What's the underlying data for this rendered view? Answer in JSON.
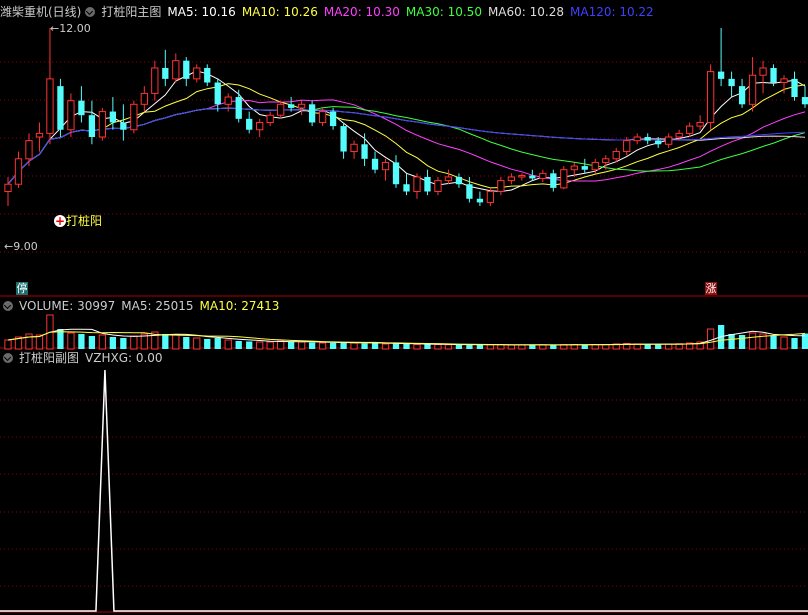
{
  "main_panel": {
    "stock_name": "潍柴重机(日线)",
    "indicator_name": "打桩阳主图",
    "ma": [
      {
        "label": "MA5: 10.16",
        "color": "#ffffff"
      },
      {
        "label": "MA10: 10.26",
        "color": "#ffff40"
      },
      {
        "label": "MA20: 10.30",
        "color": "#ff40ff"
      },
      {
        "label": "MA30: 10.50",
        "color": "#40ff40"
      },
      {
        "label": "MA60: 10.28",
        "color": "#dddddd"
      },
      {
        "label": "MA120: 10.22",
        "color": "#4040ff"
      }
    ],
    "high_label": "12.00",
    "low_label": "9.00",
    "signal_label": "打桩阳",
    "badge_left": "停",
    "badge_right": "涨"
  },
  "volume_panel": {
    "title": "VOLUME: 30997",
    "ma5": "MA5: 25015",
    "ma10": "MA10: 27413"
  },
  "sub_panel": {
    "title": "打桩阳副图",
    "value": "VZHXG: 0.00"
  },
  "colors": {
    "up": "#ff3232",
    "down": "#54fcfc",
    "grid": "#8b0000",
    "ma5": "#ffffff",
    "ma10": "#ffff40",
    "ma20": "#ff40ff",
    "ma30": "#40ff40",
    "ma60": "#dddddd",
    "ma120": "#4040ff"
  },
  "chart_data": {
    "type": "candlestick",
    "price_range": [
      9.0,
      12.0
    ],
    "candles": [
      [
        9.75,
        9.95,
        9.55,
        9.85
      ],
      [
        9.85,
        10.3,
        9.8,
        10.2
      ],
      [
        10.2,
        10.55,
        10.1,
        10.45
      ],
      [
        10.5,
        10.7,
        10.3,
        10.55
      ],
      [
        10.55,
        12.0,
        10.4,
        11.3
      ],
      [
        11.2,
        11.3,
        10.5,
        10.6
      ],
      [
        10.6,
        11.1,
        10.5,
        11.0
      ],
      [
        11.0,
        11.2,
        10.7,
        10.8
      ],
      [
        10.8,
        11.0,
        10.4,
        10.5
      ],
      [
        10.5,
        10.9,
        10.45,
        10.85
      ],
      [
        10.85,
        11.05,
        10.6,
        10.7
      ],
      [
        10.7,
        10.95,
        10.45,
        10.6
      ],
      [
        10.6,
        11.0,
        10.55,
        10.95
      ],
      [
        10.95,
        11.2,
        10.85,
        11.1
      ],
      [
        11.1,
        11.55,
        11.0,
        11.45
      ],
      [
        11.45,
        11.7,
        11.2,
        11.3
      ],
      [
        11.3,
        11.65,
        11.25,
        11.55
      ],
      [
        11.55,
        11.6,
        11.2,
        11.3
      ],
      [
        11.3,
        11.5,
        11.25,
        11.45
      ],
      [
        11.45,
        11.5,
        11.2,
        11.25
      ],
      [
        11.25,
        11.3,
        10.85,
        10.95
      ],
      [
        10.95,
        11.1,
        10.85,
        11.05
      ],
      [
        11.05,
        11.15,
        10.7,
        10.75
      ],
      [
        10.75,
        10.85,
        10.55,
        10.6
      ],
      [
        10.6,
        10.75,
        10.5,
        10.7
      ],
      [
        10.7,
        10.85,
        10.65,
        10.8
      ],
      [
        10.8,
        11.0,
        10.75,
        10.95
      ],
      [
        10.95,
        11.05,
        10.85,
        10.9
      ],
      [
        10.9,
        11.0,
        10.8,
        10.95
      ],
      [
        10.95,
        11.0,
        10.65,
        10.7
      ],
      [
        10.7,
        10.9,
        10.65,
        10.85
      ],
      [
        10.85,
        10.9,
        10.6,
        10.65
      ],
      [
        10.65,
        10.7,
        10.2,
        10.3
      ],
      [
        10.3,
        10.45,
        10.2,
        10.4
      ],
      [
        10.4,
        10.55,
        10.1,
        10.2
      ],
      [
        10.2,
        10.3,
        10.0,
        10.05
      ],
      [
        10.05,
        10.2,
        9.9,
        10.15
      ],
      [
        10.15,
        10.25,
        9.8,
        9.85
      ],
      [
        9.85,
        10.0,
        9.7,
        9.75
      ],
      [
        9.75,
        10.0,
        9.65,
        9.95
      ],
      [
        9.95,
        10.05,
        9.7,
        9.75
      ],
      [
        9.75,
        9.95,
        9.7,
        9.9
      ],
      [
        9.9,
        10.05,
        9.85,
        9.95
      ],
      [
        9.95,
        10.0,
        9.8,
        9.85
      ],
      [
        9.85,
        9.95,
        9.6,
        9.65
      ],
      [
        9.65,
        9.75,
        9.55,
        9.6
      ],
      [
        9.6,
        9.8,
        9.55,
        9.75
      ],
      [
        9.75,
        9.95,
        9.7,
        9.9
      ],
      [
        9.9,
        10.0,
        9.85,
        9.95
      ],
      [
        9.95,
        10.0,
        9.9,
        9.97
      ],
      [
        9.97,
        10.05,
        9.9,
        9.93
      ],
      [
        9.93,
        10.05,
        9.88,
        10.0
      ],
      [
        10.0,
        10.05,
        9.75,
        9.8
      ],
      [
        9.8,
        10.1,
        9.78,
        10.05
      ],
      [
        10.05,
        10.15,
        9.95,
        10.1
      ],
      [
        10.1,
        10.2,
        10.0,
        10.05
      ],
      [
        10.05,
        10.2,
        10.0,
        10.15
      ],
      [
        10.15,
        10.25,
        10.05,
        10.2
      ],
      [
        10.2,
        10.35,
        10.15,
        10.3
      ],
      [
        10.3,
        10.5,
        10.25,
        10.45
      ],
      [
        10.45,
        10.55,
        10.4,
        10.5
      ],
      [
        10.5,
        10.55,
        10.4,
        10.45
      ],
      [
        10.45,
        10.5,
        10.35,
        10.4
      ],
      [
        10.4,
        10.55,
        10.35,
        10.5
      ],
      [
        10.5,
        10.6,
        10.45,
        10.55
      ],
      [
        10.55,
        10.7,
        10.5,
        10.65
      ],
      [
        10.65,
        10.8,
        10.6,
        10.7
      ],
      [
        10.7,
        11.5,
        10.6,
        11.4
      ],
      [
        11.4,
        12.0,
        11.2,
        11.3
      ],
      [
        11.3,
        11.4,
        11.05,
        11.2
      ],
      [
        11.2,
        11.3,
        10.9,
        10.95
      ],
      [
        10.95,
        11.6,
        10.85,
        11.35
      ],
      [
        11.35,
        11.55,
        11.1,
        11.45
      ],
      [
        11.45,
        11.5,
        11.2,
        11.25
      ],
      [
        11.25,
        11.35,
        11.1,
        11.3
      ],
      [
        11.3,
        11.4,
        11.0,
        11.05
      ],
      [
        11.05,
        11.2,
        10.9,
        10.95
      ]
    ],
    "volume": [
      18000,
      24000,
      30000,
      28000,
      68000,
      40000,
      32000,
      30000,
      26000,
      28000,
      24000,
      22000,
      26000,
      30000,
      34000,
      30000,
      28000,
      24000,
      22000,
      20000,
      22000,
      18000,
      16000,
      15000,
      14000,
      14000,
      16000,
      15000,
      14000,
      13000,
      12000,
      12000,
      14000,
      12000,
      11000,
      12000,
      10000,
      11000,
      10000,
      9000,
      9000,
      9000,
      8500,
      9000,
      8000,
      8000,
      8500,
      9000,
      8000,
      8000,
      8000,
      8500,
      8000,
      9000,
      9000,
      8500,
      9000,
      9000,
      10000,
      11000,
      10000,
      9500,
      9000,
      10000,
      10500,
      12000,
      14000,
      40000,
      48000,
      30000,
      28000,
      32000,
      30000,
      26000,
      24000,
      22000,
      31000
    ],
    "sub_signal": {
      "peak_index": 4,
      "value": 0.0
    }
  }
}
